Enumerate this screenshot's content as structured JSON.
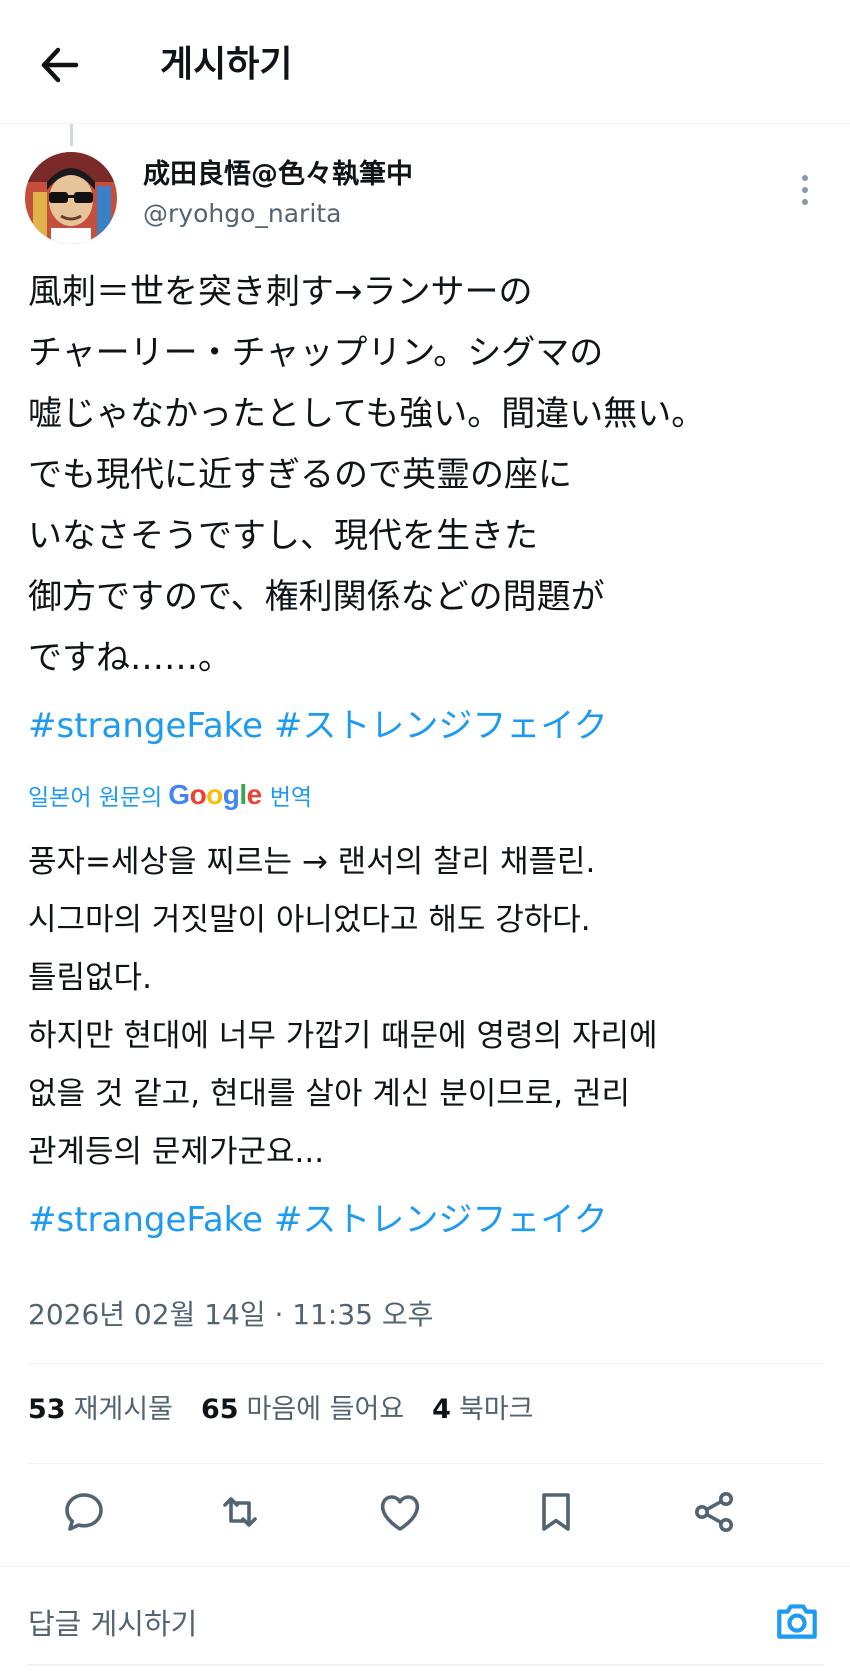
{
  "header": {
    "title": "게시하기",
    "back_icon": "arrow-left-icon"
  },
  "author": {
    "display_name": "成田良悟@色々執筆中",
    "handle": "@ryohgo_narita",
    "avatar_icon": "profile-avatar"
  },
  "post": {
    "original_text": "風刺＝世を突き刺す→ランサーの\nチャーリー・チャップリン。シグマの\n嘘じゃなかったとしても強い。間違い無い。\nでも現代に近すぎるので英霊の座に\nいなさそうですし、現代を生きた\n御方ですので、権利関係などの問題が\nですね……。",
    "hashtags": [
      "#strangeFake",
      "#ストレンジフェイク"
    ],
    "translation_label_prefix": "일본어 원문의",
    "translation_label_suffix": "번역",
    "google_brand": "Google",
    "translated_text": "풍자=세상을 찌르는 → 랜서의 찰리 채플린.\n시그마의 거짓말이 아니었다고 해도 강하다.\n틀림없다.\n하지만 현대에 너무 가깝기 때문에 영령의 자리에\n없을 것 같고, 현대를 살아 계신 분이므로, 권리\n관계등의 문제가군요...",
    "translated_hashtags": [
      "#strangeFake",
      "#ストレンジフェイク"
    ],
    "timestamp": "2026년 02월 14일 · 11:35 오후"
  },
  "stats": {
    "reposts_count": "53",
    "reposts_label": "재게시물",
    "likes_count": "65",
    "likes_label": "마음에 들어요",
    "bookmarks_count": "4",
    "bookmarks_label": "북마크"
  },
  "actions": [
    "reply-icon",
    "repost-icon",
    "heart-icon",
    "bookmark-icon",
    "share-icon"
  ],
  "reply": {
    "placeholder": "답글 게시하기",
    "camera_icon": "camera-icon"
  },
  "colors": {
    "accent": "#1d9bf0",
    "secondary_text": "#536471",
    "divider": "#eff3f4"
  }
}
